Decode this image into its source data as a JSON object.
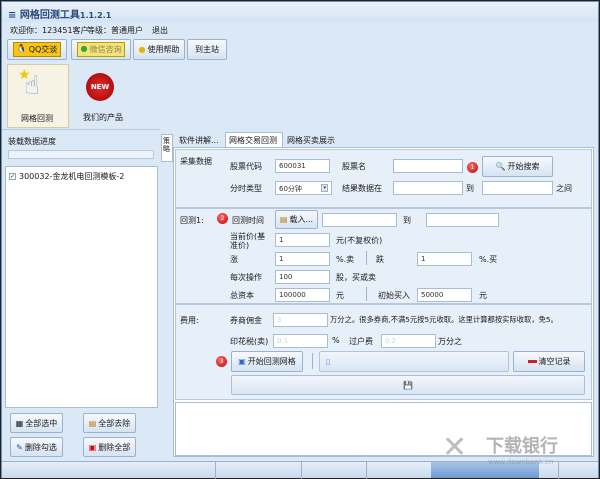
{
  "window": {
    "title": "网格回测工具",
    "version": "1.1.2.1"
  },
  "userbar": {
    "welcome": "欢迎你：123451客户",
    "level": "等级：普通用户",
    "logout": "退出"
  },
  "toolbar": [
    {
      "label": "QQ交谈",
      "icon": "qq-icon"
    },
    {
      "label": "微信咨询",
      "icon": "wechat-icon"
    },
    {
      "label": "使用帮助",
      "icon": "lightbulb-icon"
    },
    {
      "label": "到主站",
      "icon": ""
    }
  ],
  "big_tabs": [
    {
      "label": "网格回测",
      "icon": "pointing-hand-star-icon",
      "active": true
    },
    {
      "label": "我们的产品",
      "icon": "new-badge-icon",
      "badge_text": "NEW"
    }
  ],
  "left": {
    "progress_label": "装载数据进度",
    "progress": 0,
    "items": [
      {
        "label": "300032-金龙机电回测模板-2",
        "checked": true
      }
    ],
    "buttons": [
      "全部选中",
      "全部去除",
      "删除勾选",
      "删除全部"
    ]
  },
  "side_tab": "策略",
  "tabs": [
    "软件讲解...",
    "网格交易回测",
    "网格买卖展示"
  ],
  "active_tab": 1,
  "collect": {
    "section": "采集数据",
    "code_label": "股票代码",
    "code": "600031",
    "name_label": "股票名",
    "name": "",
    "search": "开始搜索",
    "period_label": "分时类型",
    "period": "60分钟",
    "result_label": "结果数据在",
    "to": "到",
    "between": "之间",
    "from_val": "",
    "to_val": ""
  },
  "backtest": {
    "section": "回测1:",
    "time_label": "回测时间",
    "load": "载入...",
    "to": "到",
    "start": "",
    "end": "",
    "price_label": "当前价(基准价)",
    "price": "1",
    "price_unit": "元(不复权价)",
    "rise_label": "涨",
    "rise": "1",
    "rise_unit": "%.卖",
    "fall_label": "跌",
    "fall": "1",
    "fall_unit": "%.买",
    "op_label": "每次操作",
    "op": "100",
    "op_unit": "股，买或卖",
    "capital_label": "总资本",
    "capital": "100000",
    "capital_unit": "元",
    "init_label": "初始买入",
    "init": "50000",
    "init_unit": "元"
  },
  "fees": {
    "section": "费用:",
    "commission_label": "券商佣金",
    "commission": "3",
    "commission_note": "万分之。很多券商,不满5元按5元收取。这里计算都按实际收取，免5。",
    "stamp_label": "印花税(卖)",
    "stamp": "0.1",
    "stamp_unit": "%",
    "transfer_label": "过户费",
    "transfer": "0.2",
    "transfer_unit": "万分之"
  },
  "actions": {
    "start": "开始回测网格",
    "clear": "清空记录"
  },
  "badges": [
    "1",
    "2",
    "3"
  ],
  "watermark": {
    "name": "下载银行",
    "url": "www.downbank.cn"
  }
}
